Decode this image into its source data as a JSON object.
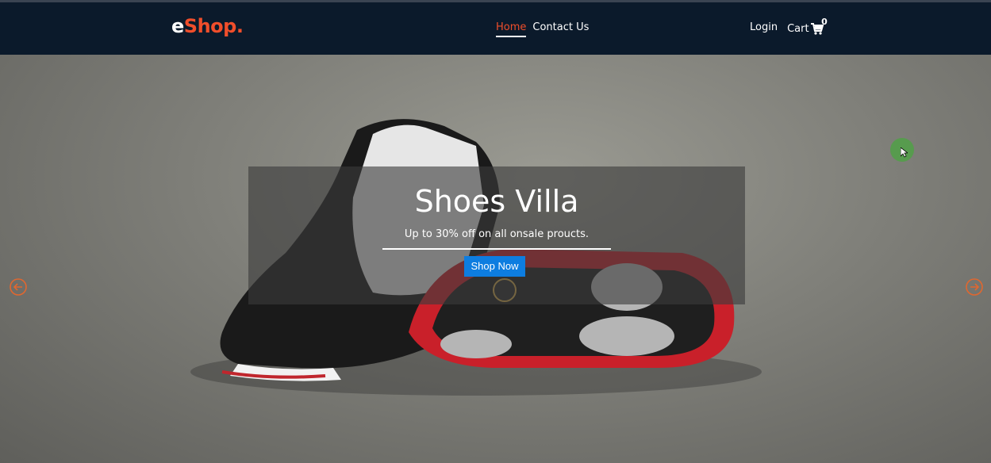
{
  "brand": {
    "logo_e": "e",
    "logo_rest": "Shop."
  },
  "nav": {
    "home": "Home",
    "contact": "Contact Us",
    "login": "Login",
    "cart": "Cart",
    "cart_count": "0"
  },
  "hero": {
    "title": "Shoes Villa",
    "subtitle": "Up to 30% off on all onsale proucts.",
    "button": "Shop Now"
  },
  "icons": {
    "cart": "cart-icon",
    "prev": "arrow-left-circle-icon",
    "next": "arrow-right-circle-icon"
  },
  "colors": {
    "nav_bg": "#0b1a2b",
    "accent": "#f04e2b",
    "button": "#0d7de0"
  }
}
